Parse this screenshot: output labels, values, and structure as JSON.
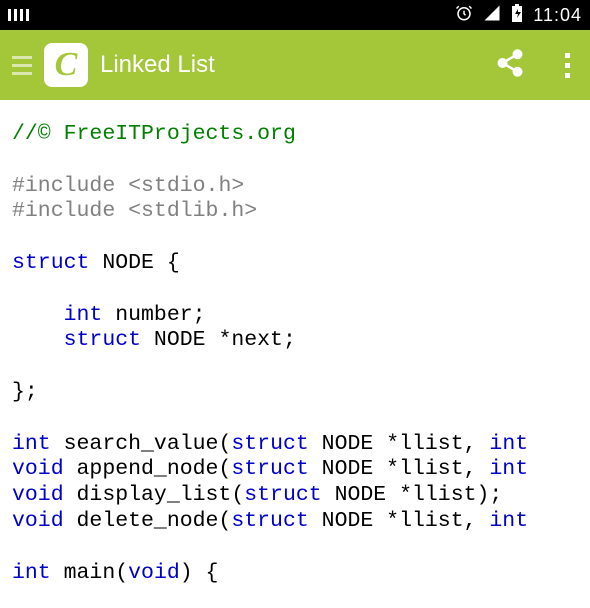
{
  "status": {
    "time": "11:04"
  },
  "appbar": {
    "title": "Linked List",
    "icon_letter": "C"
  },
  "code": {
    "l1": "//© FreeITProjects.org",
    "l2": "",
    "l3a": "#include ",
    "l3b": "<stdio.h>",
    "l4a": "#include ",
    "l4b": "<stdlib.h>",
    "l5": "",
    "l6a": "struct",
    "l6b": " NODE {",
    "l7": "",
    "l8a": "    ",
    "l8b": "int",
    "l8c": " number;",
    "l9a": "    ",
    "l9b": "struct",
    "l9c": " NODE *next;",
    "l10": "",
    "l11": "};",
    "l12": "",
    "l13a": "int",
    "l13b": " search_value(",
    "l13c": "struct",
    "l13d": " NODE *llist, ",
    "l13e": "int",
    "l14a": "void",
    "l14b": " append_node(",
    "l14c": "struct",
    "l14d": " NODE *llist, ",
    "l14e": "int",
    "l15a": "void",
    "l15b": " display_list(",
    "l15c": "struct",
    "l15d": " NODE *llist);",
    "l16a": "void",
    "l16b": " delete_node(",
    "l16c": "struct",
    "l16d": " NODE *llist, ",
    "l16e": "int",
    "l17": "",
    "l18a": "int",
    "l18b": " main(",
    "l18c": "void",
    "l18d": ") {"
  }
}
